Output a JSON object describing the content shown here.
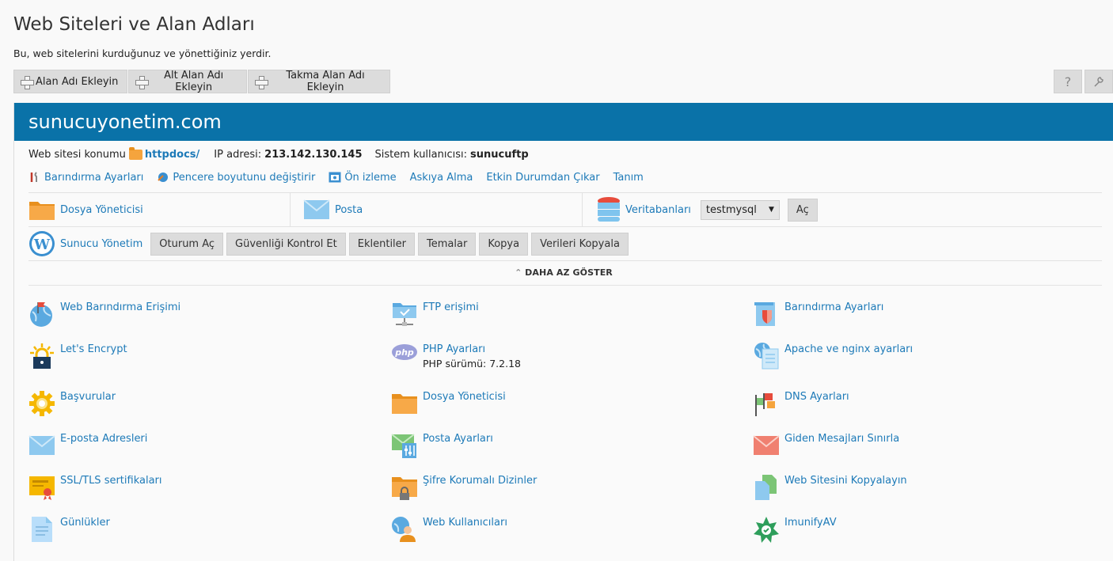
{
  "page": {
    "title": "Web Siteleri ve Alan Adları",
    "description": "Bu, web sitelerini kurduğunuz ve yönettiğiniz yerdir."
  },
  "toolbar": {
    "buttons": [
      "Alan Adı Ekleyin",
      "Alt Alan Adı Ekleyin",
      "Takma Alan Adı Ekleyin"
    ],
    "help_icon": "question-icon",
    "settings_icon": "wrench-icon"
  },
  "domain": {
    "name": "sunucuyonetim.com",
    "location_label": "Web sitesi konumu",
    "location_value": "httpdocs/",
    "ip_label": "IP adresi:",
    "ip_value": "213.142.130.145",
    "user_label": "Sistem kullanıcısı:",
    "user_value": "sunucuftp"
  },
  "actions": [
    "Barındırma Ayarları",
    "Pencere boyutunu değiştirir",
    "Ön izleme",
    "Askıya Alma",
    "Etkin Durumdan Çıkar",
    "Tanım"
  ],
  "tools": {
    "file_manager": "Dosya Yöneticisi",
    "mail": "Posta",
    "databases": "Veritabanları",
    "db_selected": "testmysql",
    "open_button": "Aç"
  },
  "wordpress": {
    "name": "Sunucu Yönetim",
    "buttons": [
      "Oturum Aç",
      "Güvenliği Kontrol Et",
      "Eklentiler",
      "Temalar",
      "Kopya",
      "Verileri Kopyala"
    ]
  },
  "show_less": "DAHA AZ GÖSTER",
  "grid": [
    {
      "label": "Web Barındırma Erişimi",
      "icon": "globe-flag-icon"
    },
    {
      "label": "FTP erişimi",
      "icon": "ftp-folder-icon"
    },
    {
      "label": "Barındırma Ayarları",
      "icon": "hosting-settings-icon"
    },
    {
      "label": "Let's Encrypt",
      "icon": "lets-encrypt-icon"
    },
    {
      "label": "PHP Ayarları",
      "icon": "php-icon",
      "sub": "PHP sürümü: 7.2.18"
    },
    {
      "label": "Apache ve nginx ayarları",
      "icon": "apache-icon"
    },
    {
      "label": "Başvurular",
      "icon": "gear-icon"
    },
    {
      "label": "Dosya Yöneticisi",
      "icon": "folder-icon"
    },
    {
      "label": "DNS Ayarları",
      "icon": "dns-flags-icon"
    },
    {
      "label": "E-posta Adresleri",
      "icon": "envelope-icon"
    },
    {
      "label": "Posta Ayarları",
      "icon": "mail-settings-icon"
    },
    {
      "label": "Giden Mesajları Sınırla",
      "icon": "envelope-red-icon"
    },
    {
      "label": "SSL/TLS sertifikaları",
      "icon": "certificate-icon"
    },
    {
      "label": "Şifre Korumalı Dizinler",
      "icon": "locked-folder-icon"
    },
    {
      "label": "Web Sitesini Kopyalayın",
      "icon": "copy-pages-icon"
    },
    {
      "label": "Günlükler",
      "icon": "log-file-icon"
    },
    {
      "label": "Web Kullanıcıları",
      "icon": "web-user-icon"
    },
    {
      "label": "ImunifyAV",
      "icon": "imunify-icon"
    }
  ],
  "colors": {
    "header": "#0a72a8",
    "link": "#1d7ab8",
    "button": "#dcdcdc"
  }
}
